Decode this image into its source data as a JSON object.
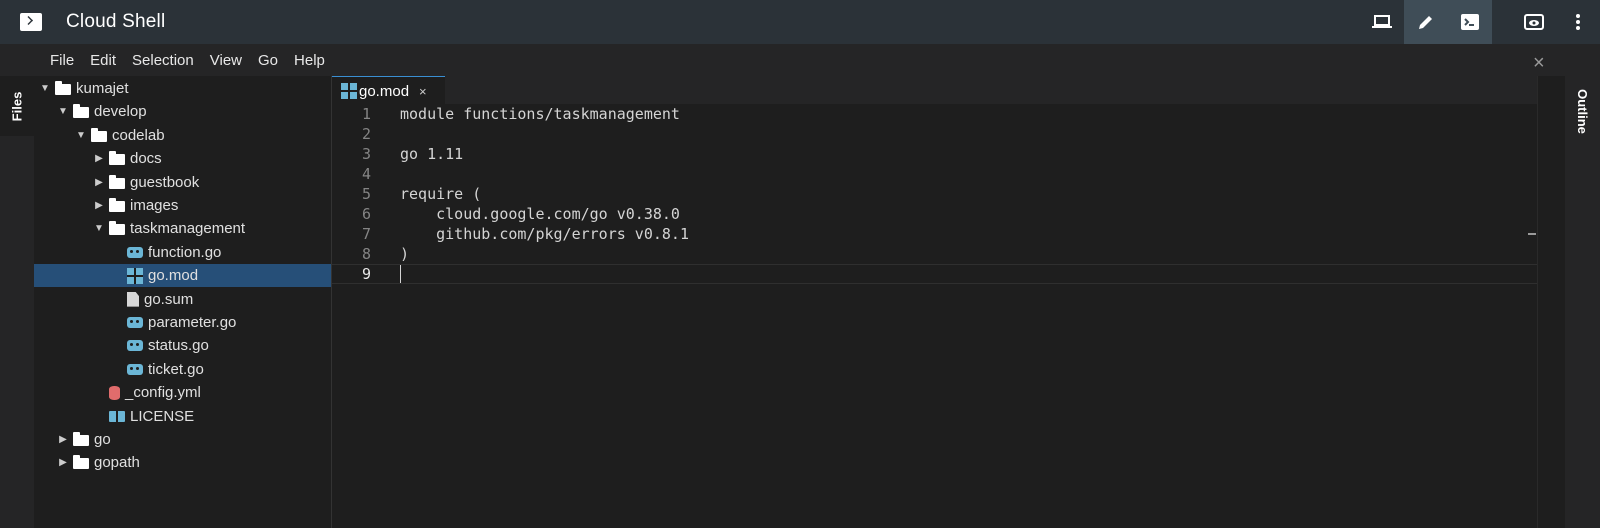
{
  "app": {
    "title": "Cloud Shell",
    "actions": [
      {
        "name": "laptop-icon",
        "glyph": "💻"
      },
      {
        "name": "pencil-icon",
        "glyph": "✎"
      },
      {
        "name": "terminal-icon",
        "glyph": ">_"
      },
      {
        "name": "preview-icon",
        "glyph": "◉"
      },
      {
        "name": "more-vert-icon",
        "glyph": "⋮"
      }
    ]
  },
  "menu": [
    "File",
    "Edit",
    "Selection",
    "View",
    "Go",
    "Help"
  ],
  "left_rail": {
    "label": "Files"
  },
  "right_rail": {
    "label": "Outline"
  },
  "tree": [
    {
      "label": "kumajet",
      "depth": 0,
      "kind": "folder",
      "expanded": true
    },
    {
      "label": "develop",
      "depth": 1,
      "kind": "folder",
      "expanded": true
    },
    {
      "label": "codelab",
      "depth": 2,
      "kind": "folder",
      "expanded": true
    },
    {
      "label": "docs",
      "depth": 3,
      "kind": "folder",
      "expanded": false
    },
    {
      "label": "guestbook",
      "depth": 3,
      "kind": "folder",
      "expanded": false
    },
    {
      "label": "images",
      "depth": 3,
      "kind": "folder",
      "expanded": false
    },
    {
      "label": "taskmanagement",
      "depth": 3,
      "kind": "folder",
      "expanded": true
    },
    {
      "label": "function.go",
      "depth": 4,
      "kind": "go"
    },
    {
      "label": "go.mod",
      "depth": 4,
      "kind": "mod",
      "selected": true
    },
    {
      "label": "go.sum",
      "depth": 4,
      "kind": "file"
    },
    {
      "label": "parameter.go",
      "depth": 4,
      "kind": "go"
    },
    {
      "label": "status.go",
      "depth": 4,
      "kind": "go"
    },
    {
      "label": "ticket.go",
      "depth": 4,
      "kind": "go"
    },
    {
      "label": "_config.yml",
      "depth": 3,
      "kind": "db"
    },
    {
      "label": "LICENSE",
      "depth": 3,
      "kind": "book"
    },
    {
      "label": "go",
      "depth": 1,
      "kind": "folder",
      "expanded": false
    },
    {
      "label": "gopath",
      "depth": 1,
      "kind": "folder",
      "expanded": false
    }
  ],
  "editor": {
    "tab": {
      "label": "go.mod",
      "close": "×"
    },
    "lines": [
      {
        "n": "1",
        "text": "module functions/taskmanagement"
      },
      {
        "n": "2",
        "text": ""
      },
      {
        "n": "3",
        "text": "go 1.11"
      },
      {
        "n": "4",
        "text": ""
      },
      {
        "n": "5",
        "text": "require ("
      },
      {
        "n": "6",
        "text": "    cloud.google.com/go v0.38.0"
      },
      {
        "n": "7",
        "text": "    github.com/pkg/errors v0.8.1"
      },
      {
        "n": "8",
        "text": ")"
      },
      {
        "n": "9",
        "text": "",
        "current": true
      }
    ]
  },
  "panel_close": "×"
}
